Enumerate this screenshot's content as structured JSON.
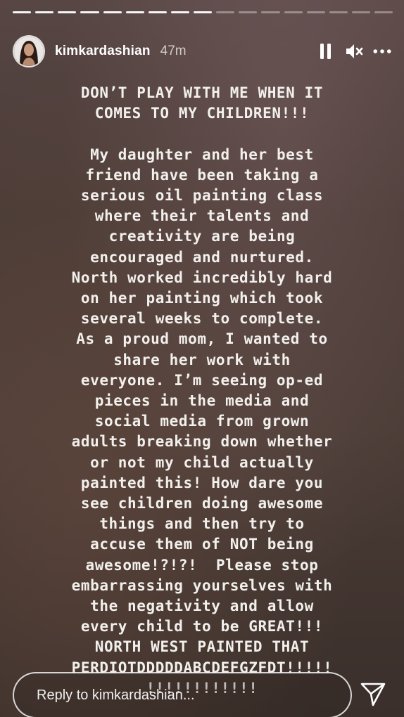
{
  "progress": {
    "total_segments": 17,
    "completed_segments": 9
  },
  "header": {
    "username": "kimkardashian",
    "time_ago": "47m",
    "avatar_icon": "profile-photo",
    "pause_icon": "pause-icon",
    "mute_icon": "speaker-muted-icon",
    "more_icon": "more-horizontal-icon"
  },
  "story_text": {
    "paragraphs": [
      [
        "DON’T PLAY WITH ME WHEN IT",
        "COMES TO MY CHILDREN!!!"
      ],
      [
        "My daughter and her best",
        "friend have been taking a",
        "serious oil painting class",
        "where their talents and",
        "creativity are being",
        "encouraged and nurtured.",
        "North worked incredibly hard",
        "on her painting which took",
        "several weeks to complete.",
        "As a proud mom, I wanted to",
        "share her work with",
        "everyone. I’m seeing op-ed",
        "pieces in the media and",
        "social media from grown",
        "adults breaking down whether",
        "or not my child actually",
        "painted this! How dare you",
        "see children doing awesome",
        "things and then try to",
        "accuse them of NOT being",
        "awesome!?!?!  Please stop",
        "embarrassing yourselves with",
        "the negativity and allow",
        "every child to be GREAT!!!",
        "NORTH WEST PAINTED THAT",
        "PERDIOTDDDDDABCDEFGZFDT!!!!!",
        "!!!!!!!!!!!!"
      ]
    ]
  },
  "reply": {
    "placeholder": "Reply to kimkardashian...",
    "value": "",
    "send_icon": "send-icon"
  },
  "colors": {
    "text": "#f2f0ec",
    "background_top": "#574644",
    "background_bottom": "#3a2f2b"
  }
}
